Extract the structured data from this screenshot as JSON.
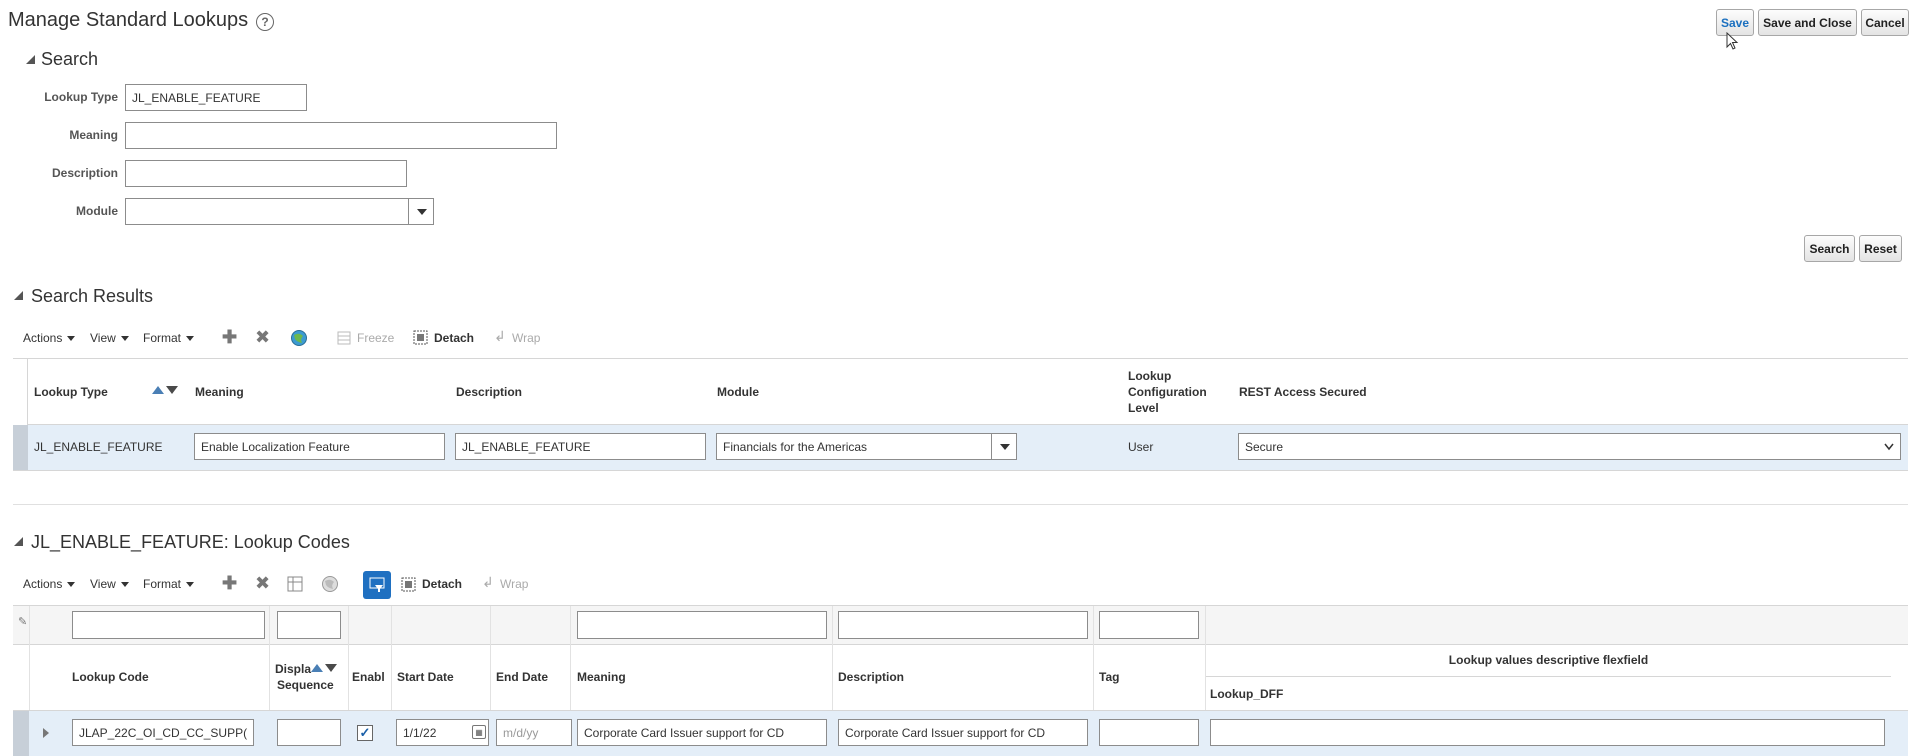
{
  "page": {
    "title": "Manage Standard Lookups",
    "help_icon": "?",
    "save_label": "Save",
    "save_close_label": "Save and Close",
    "cancel_label": "Cancel"
  },
  "search": {
    "title": "Search",
    "lookup_type_label": "Lookup Type",
    "lookup_type_value": "JL_ENABLE_FEATURE",
    "meaning_label": "Meaning",
    "meaning_value": "",
    "description_label": "Description",
    "description_value": "",
    "module_label": "Module",
    "module_value": "",
    "search_button": "Search",
    "reset_button": "Reset"
  },
  "results": {
    "title": "Search Results",
    "toolbar": {
      "actions": "Actions",
      "view": "View",
      "format": "Format",
      "freeze": "Freeze",
      "detach": "Detach",
      "wrap": "Wrap"
    },
    "columns": {
      "lookup_type": "Lookup Type",
      "meaning": "Meaning",
      "description": "Description",
      "module": "Module",
      "config_level_1": "Lookup",
      "config_level_2": "Configuration",
      "config_level_3": "Level",
      "rest_access": "REST Access Secured"
    },
    "row": {
      "lookup_type": "JL_ENABLE_FEATURE",
      "meaning": "Enable Localization Feature",
      "description": "JL_ENABLE_FEATURE",
      "module": "Financials for the Americas",
      "config_level": "User",
      "rest_access": "Secure"
    }
  },
  "codes": {
    "title": "JL_ENABLE_FEATURE: Lookup Codes",
    "toolbar": {
      "actions": "Actions",
      "view": "View",
      "format": "Format",
      "detach": "Detach",
      "wrap": "Wrap"
    },
    "columns": {
      "lookup_code": "Lookup Code",
      "display_seq_1": "Displa",
      "display_seq_2": "Sequence",
      "enabled": "Enabl",
      "start_date": "Start Date",
      "end_date": "End Date",
      "meaning": "Meaning",
      "description": "Description",
      "tag": "Tag",
      "dff_group": "Lookup values descriptive flexfield",
      "dff": "Lookup_DFF"
    },
    "row": {
      "lookup_code": "JLAP_22C_OI_CD_CC_SUPP(",
      "display_seq": "",
      "enabled_mark": "✓",
      "start_date": "1/1/22",
      "end_date_placeholder": "m/d/yy",
      "meaning": "Corporate Card Issuer support for CD",
      "description": "Corporate Card Issuer support for CD",
      "tag": "",
      "dff": ""
    }
  },
  "colors": {
    "accent": "#1a6fbf",
    "row_selected": "#e4eef8",
    "header_bg": "#f5f5f5",
    "filter_active": "#1f70c1"
  }
}
